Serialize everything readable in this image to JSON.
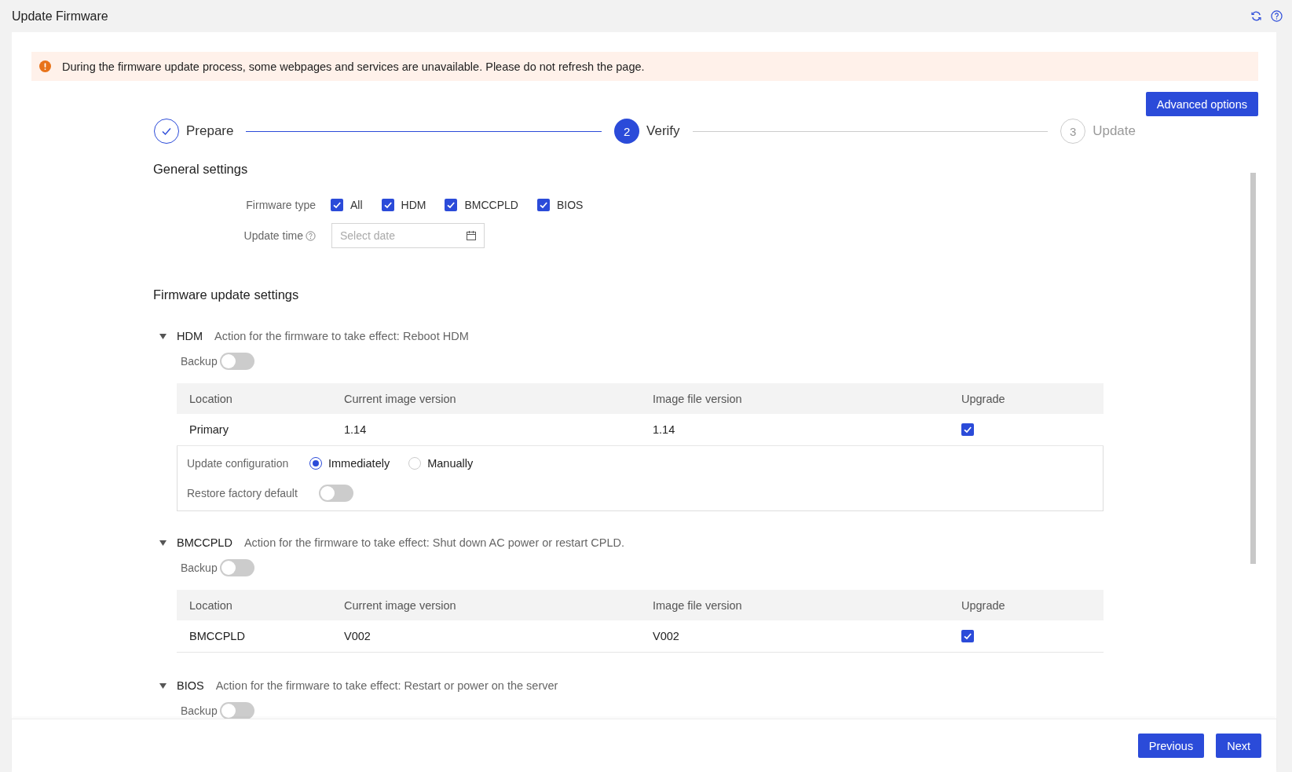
{
  "header": {
    "title": "Update Firmware"
  },
  "alert": {
    "message": "During the firmware update process, some webpages and services are unavailable. Please do not refresh the page."
  },
  "advanced_button": "Advanced options",
  "steps": [
    {
      "label": "Prepare",
      "done": true,
      "selected": false
    },
    {
      "number": "2",
      "label": "Verify",
      "done": false,
      "selected": true
    },
    {
      "number": "3",
      "label": "Update",
      "done": false,
      "selected": false
    }
  ],
  "general_settings": {
    "title": "General settings",
    "firmware_type": {
      "label": "Firmware type",
      "options": [
        {
          "label": "All",
          "checked": true
        },
        {
          "label": "HDM",
          "checked": true
        },
        {
          "label": "BMCCPLD",
          "checked": true
        },
        {
          "label": "BIOS",
          "checked": true
        }
      ]
    },
    "update_time": {
      "label": "Update time",
      "placeholder": "Select date"
    }
  },
  "firmware_update_settings": {
    "title": "Firmware update settings",
    "sections": [
      {
        "name": "HDM",
        "action": "Action for the firmware to take effect: Reboot HDM",
        "expanded": true,
        "backup": {
          "label": "Backup",
          "on": false
        },
        "table": {
          "columns": [
            "Location",
            "Current image version",
            "Image file version",
            "Upgrade"
          ],
          "rows": [
            {
              "cells": [
                "Primary",
                "1.14",
                "1.14"
              ],
              "upgrade": true
            }
          ]
        },
        "config": {
          "label": "Update configuration",
          "options": [
            {
              "label": "Immediately",
              "selected": true
            },
            {
              "label": "Manually",
              "selected": false
            }
          ],
          "restore": {
            "label": "Restore factory default",
            "on": false
          }
        }
      },
      {
        "name": "BMCCPLD",
        "action": "Action for the firmware to take effect: Shut down AC power or restart CPLD.",
        "expanded": true,
        "backup": {
          "label": "Backup",
          "on": false
        },
        "table": {
          "columns": [
            "Location",
            "Current image version",
            "Image file version",
            "Upgrade"
          ],
          "rows": [
            {
              "cells": [
                "BMCCPLD",
                "V002",
                "V002"
              ],
              "upgrade": true
            }
          ]
        }
      },
      {
        "name": "BIOS",
        "action": "Action for the firmware to take effect: Restart or power on the server",
        "expanded": true,
        "backup": {
          "label": "Backup",
          "on": false
        }
      }
    ]
  },
  "footer": {
    "buttons": [
      "Previous",
      "Next"
    ]
  }
}
